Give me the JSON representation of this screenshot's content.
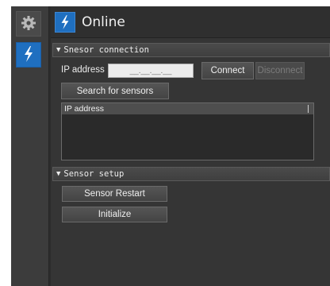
{
  "header": {
    "title": "Online"
  },
  "sensor_connection": {
    "section_label": "Snesor connection",
    "ip_label": "IP address",
    "ip_value": "__.__.__.__",
    "connect_label": "Connect",
    "disconnect_label": "Disconnect",
    "search_label": "Search for sensors",
    "list_header": "IP address"
  },
  "sensor_setup": {
    "section_label": "Sensor setup",
    "restart_label": "Sensor Restart",
    "initialize_label": "Initialize"
  },
  "colors": {
    "accent": "#1f6fc0",
    "panel": "#353535",
    "section_bar": "#444444"
  },
  "icons": {
    "settings": "gear-icon",
    "online": "lightning-icon"
  }
}
